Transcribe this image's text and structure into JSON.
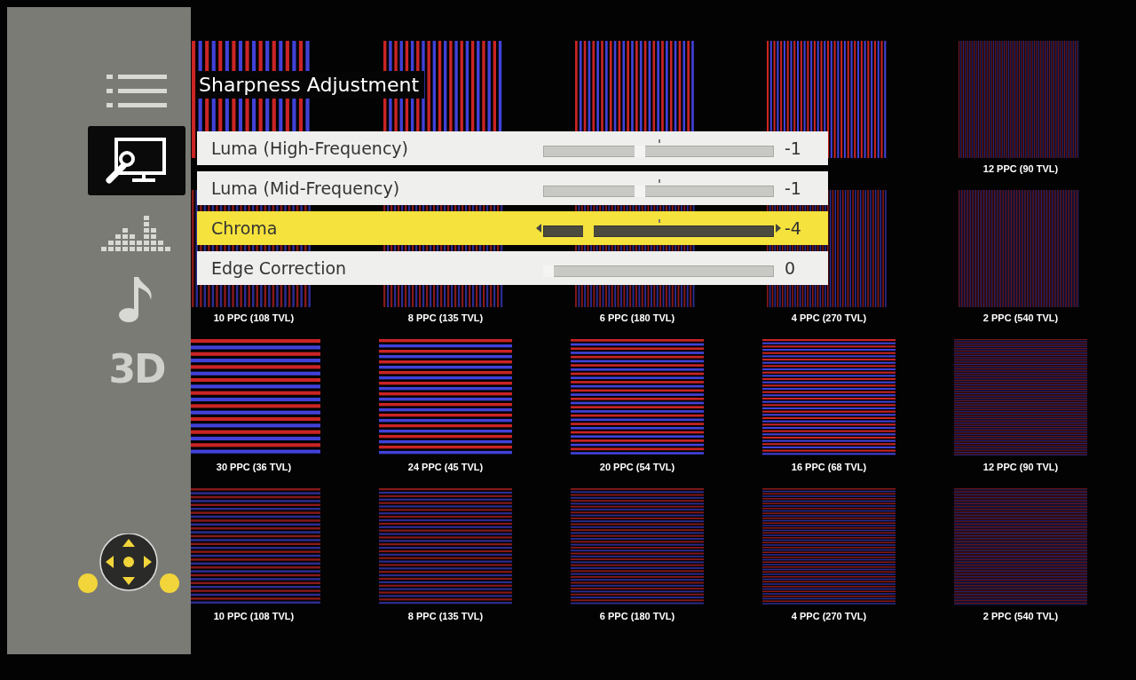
{
  "sidebar": {
    "items": [
      {
        "kind": "list",
        "selected": false
      },
      {
        "kind": "picture-settings",
        "selected": true
      },
      {
        "kind": "equalizer",
        "selected": false
      },
      {
        "kind": "music",
        "selected": false
      },
      {
        "kind": "text",
        "label": "3D",
        "selected": false
      }
    ]
  },
  "pattern_rows": [
    {
      "kind": "vertical",
      "labels": [
        "12 PPC (90 TVL)"
      ]
    },
    {
      "kind": "vertical",
      "labels": [
        "10 PPC (108 TVL)",
        "8 PPC (135 TVL)",
        "6 PPC (180 TVL)",
        "4 PPC (270 TVL)",
        "2 PPC (540 TVL)"
      ]
    },
    {
      "kind": "horizontal",
      "labels": [
        "30 PPC (36 TVL)",
        "24 PPC (45 TVL)",
        "20 PPC (54 TVL)",
        "16 PPC (68 TVL)",
        "12 PPC (90 TVL)"
      ]
    },
    {
      "kind": "horizontal",
      "labels": [
        "10 PPC (108 TVL)",
        "8 PPC (135 TVL)",
        "6 PPC (180 TVL)",
        "4 PPC (270 TVL)",
        "2 PPC (540 TVL)"
      ]
    }
  ],
  "menu": {
    "title": "Sharpness Adjustment",
    "rows": [
      {
        "label": "Luma (High-Frequency)",
        "level": 0.415,
        "value": "-1",
        "centered": true,
        "selected": false
      },
      {
        "label": "Luma (Mid-Frequency)",
        "level": 0.415,
        "value": "-1",
        "centered": true,
        "selected": false
      },
      {
        "label": "Chroma",
        "level": 0.18,
        "value": "-4",
        "centered": true,
        "selected": true
      },
      {
        "label": "Edge Correction",
        "level": 0.0,
        "value": "0",
        "centered": false,
        "selected": false
      }
    ]
  }
}
